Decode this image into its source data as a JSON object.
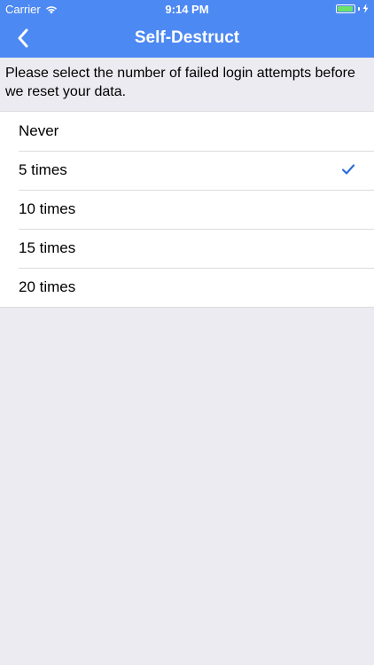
{
  "status_bar": {
    "carrier": "Carrier",
    "time": "9:14 PM",
    "battery_level": 0.95,
    "battery_color": "#6be36b",
    "icons": [
      "wifi-icon",
      "battery-icon",
      "charging-bolt-icon"
    ]
  },
  "nav": {
    "title": "Self-Destruct",
    "back_icon": "chevron-left-icon",
    "bar_color": "#4d89f2"
  },
  "description": "Please select the number of failed login attempts before we reset your data.",
  "options": [
    {
      "label": "Never",
      "selected": false
    },
    {
      "label": "5 times",
      "selected": true
    },
    {
      "label": "10 times",
      "selected": false
    },
    {
      "label": "15 times",
      "selected": false
    },
    {
      "label": "20 times",
      "selected": false
    }
  ],
  "accent_color": "#2f6fd8",
  "background_color": "#ebebf1"
}
